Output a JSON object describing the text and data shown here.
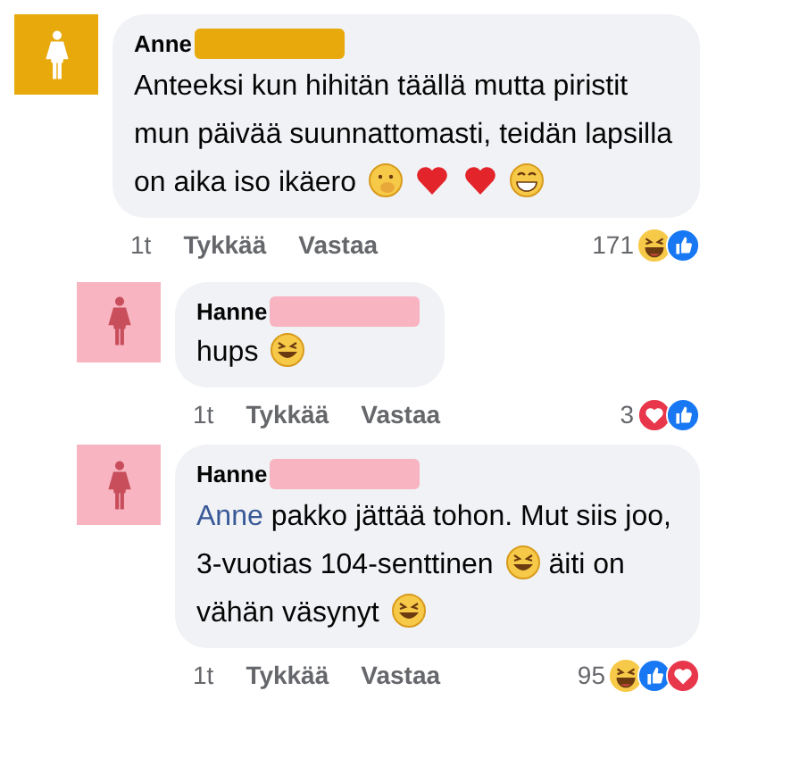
{
  "comments": [
    {
      "author": "Anne",
      "color": "#e8a90c",
      "segments": [
        {
          "kind": "text",
          "text": "Anteeksi kun hihitän täällä mutta piristit mun päivää suunnattomasti, teidän lapsilla on aika iso ikäero"
        },
        {
          "kind": "hand-over-mouth"
        },
        {
          "kind": "heart"
        },
        {
          "kind": "heart"
        },
        {
          "kind": "grin"
        }
      ],
      "time": "1t",
      "like": "Tykkää",
      "reply": "Vastaa",
      "reaction_count": "171",
      "reactions": [
        {
          "kind": "haha"
        },
        {
          "kind": "like"
        }
      ],
      "children": [
        {
          "author": "Hanne",
          "color": "#f8b4c0",
          "segments": [
            {
              "kind": "text",
              "text": "hups"
            },
            {
              "kind": "rofl"
            }
          ],
          "time": "1t",
          "like": "Tykkää",
          "reply": "Vastaa",
          "reaction_count": "3",
          "reactions": [
            {
              "kind": "love"
            },
            {
              "kind": "like"
            }
          ]
        },
        {
          "author": "Hanne",
          "color": "#f8b4c0",
          "segments": [
            {
              "kind": "mention",
              "text": "Anne"
            },
            {
              "kind": "text",
              "text": "pakko jättää tohon. Mut siis joo, 3-vuotias 104-senttinen"
            },
            {
              "kind": "rofl"
            },
            {
              "kind": "text",
              "text": "äiti on vähän väsynyt"
            },
            {
              "kind": "rofl"
            }
          ],
          "time": "1t",
          "like": "Tykkää",
          "reply": "Vastaa",
          "reaction_count": "95",
          "reactions": [
            {
              "kind": "haha"
            },
            {
              "kind": "like"
            },
            {
              "kind": "love"
            }
          ]
        }
      ]
    }
  ]
}
